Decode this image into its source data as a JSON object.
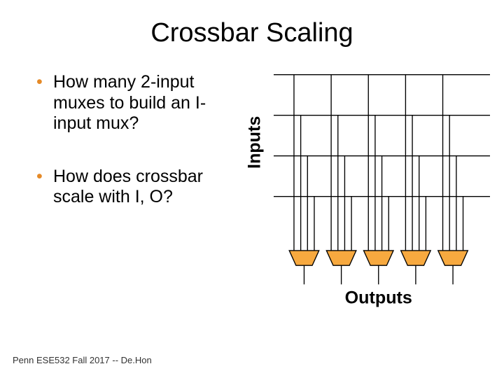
{
  "title": "Crossbar Scaling",
  "bullets": {
    "items": [
      {
        "text": "How many 2-input muxes to build an I-input mux?"
      },
      {
        "text": "How does crossbar scale with I, O?"
      }
    ]
  },
  "diagram": {
    "inputs_label": "Inputs",
    "outputs_label": "Outputs"
  },
  "footer": "Penn ESE532 Fall 2017 -- De.Hon"
}
